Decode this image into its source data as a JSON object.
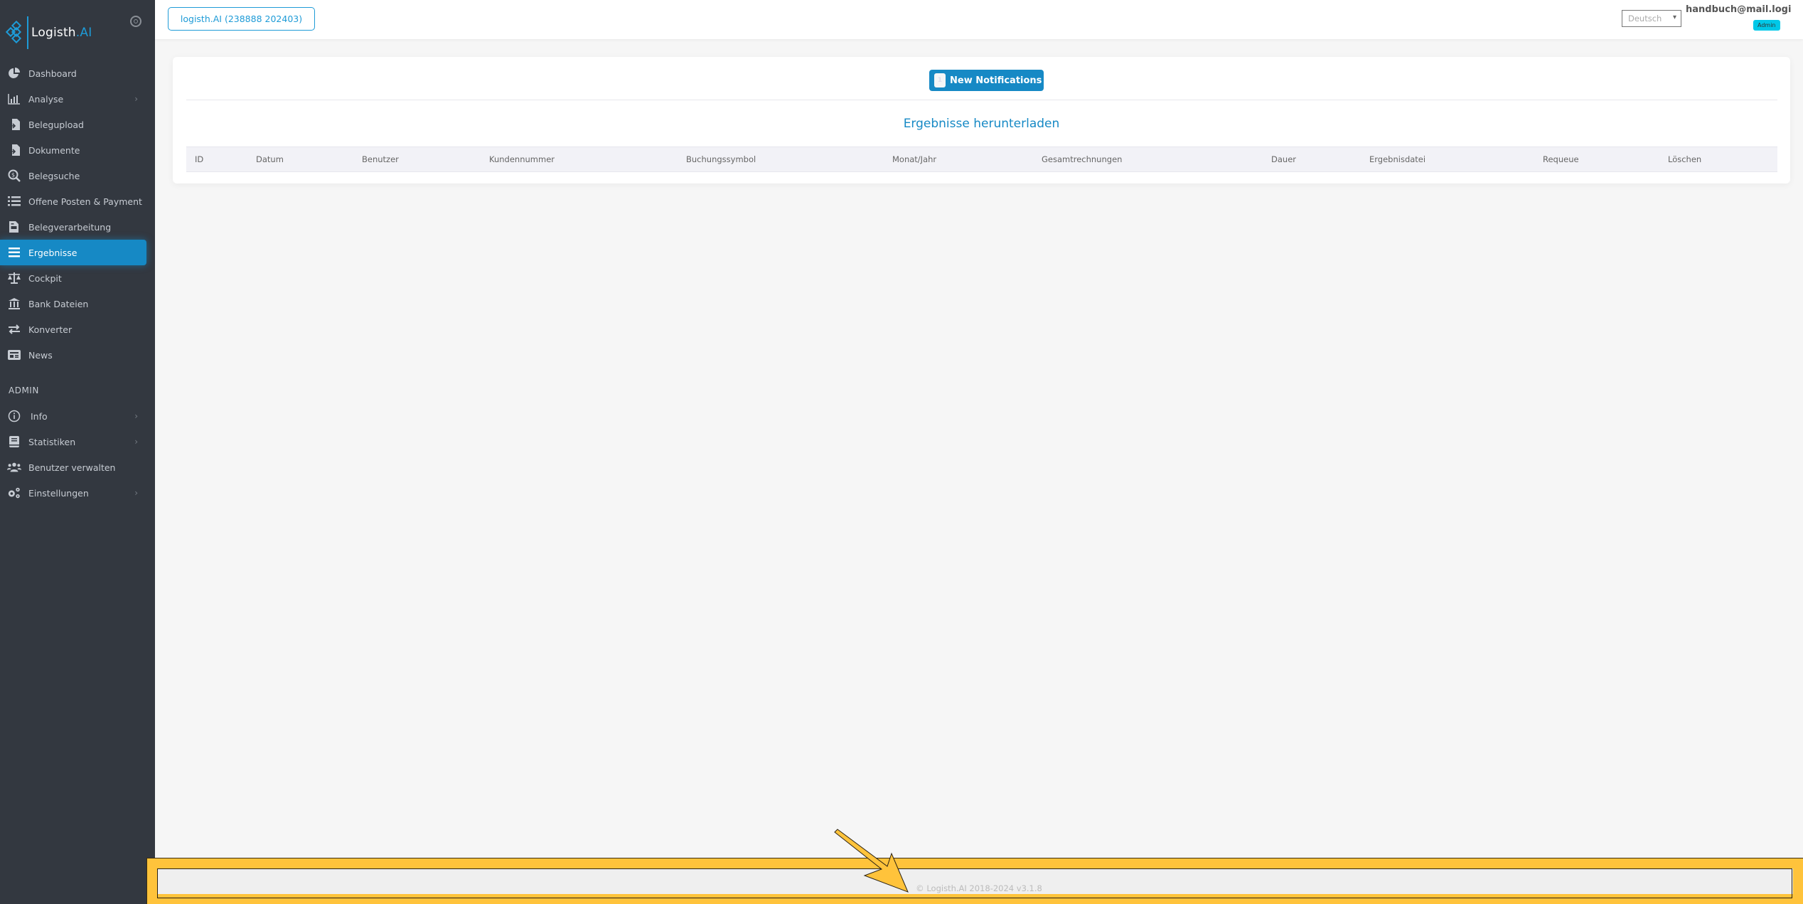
{
  "brand": {
    "name": "Logisth",
    "suffix": ".AI",
    "accent_color": "#1e9bd7"
  },
  "sidebar": {
    "toggle_icon": "circle-dot-icon",
    "items": [
      {
        "label": "Dashboard",
        "icon": "pie-chart-icon",
        "has_submenu": false
      },
      {
        "label": "Analyse",
        "icon": "bar-chart-icon",
        "has_submenu": true
      },
      {
        "label": "Belegupload",
        "icon": "file-import-icon",
        "has_submenu": false
      },
      {
        "label": "Dokumente",
        "icon": "file-import-icon",
        "has_submenu": false
      },
      {
        "label": "Belegsuche",
        "icon": "search-dollar-icon",
        "has_submenu": false
      },
      {
        "label": "Offene Posten & Payment",
        "icon": "list-icon",
        "has_submenu": false
      },
      {
        "label": "Belegverarbeitung",
        "icon": "file-invoice-icon",
        "has_submenu": false
      },
      {
        "label": "Ergebnisse",
        "icon": "bars-icon",
        "has_submenu": false,
        "active": true
      },
      {
        "label": "Cockpit",
        "icon": "balance-scale-icon",
        "has_submenu": false
      },
      {
        "label": "Bank Dateien",
        "icon": "bank-icon",
        "has_submenu": false
      },
      {
        "label": "Konverter",
        "icon": "exchange-icon",
        "has_submenu": false
      },
      {
        "label": "News",
        "icon": "newspaper-icon",
        "has_submenu": false
      }
    ],
    "admin_section_title": "ADMIN",
    "admin_items": [
      {
        "label": "Info",
        "icon": "info-circle-icon",
        "has_submenu": true
      },
      {
        "label": "Statistiken",
        "icon": "book-icon",
        "has_submenu": true
      },
      {
        "label": "Benutzer verwalten",
        "icon": "users-icon",
        "has_submenu": false
      },
      {
        "label": "Einstellungen",
        "icon": "cogs-icon",
        "has_submenu": true
      }
    ]
  },
  "topbar": {
    "company_button": "logisth.AI (238888 202403)",
    "language": "Deutsch",
    "user_email": "handbuch@mail.logi",
    "role_badge": "Admin"
  },
  "main": {
    "notifications": {
      "count": "1",
      "label": "New Notifications"
    },
    "title": "Ergebnisse herunterladen",
    "table": {
      "columns": [
        "ID",
        "Datum",
        "Benutzer",
        "Kundennummer",
        "Buchungssymbol",
        "Monat/Jahr",
        "Gesamtrechnungen",
        "Dauer",
        "Ergebnisdatei",
        "Requeue",
        "Löschen"
      ],
      "rows": []
    }
  },
  "footer": {
    "text": "© Logisth.AI 2018-2024 v3.1.8"
  },
  "annotation": {
    "highlight_color": "#ffc33b",
    "target": "footer"
  }
}
